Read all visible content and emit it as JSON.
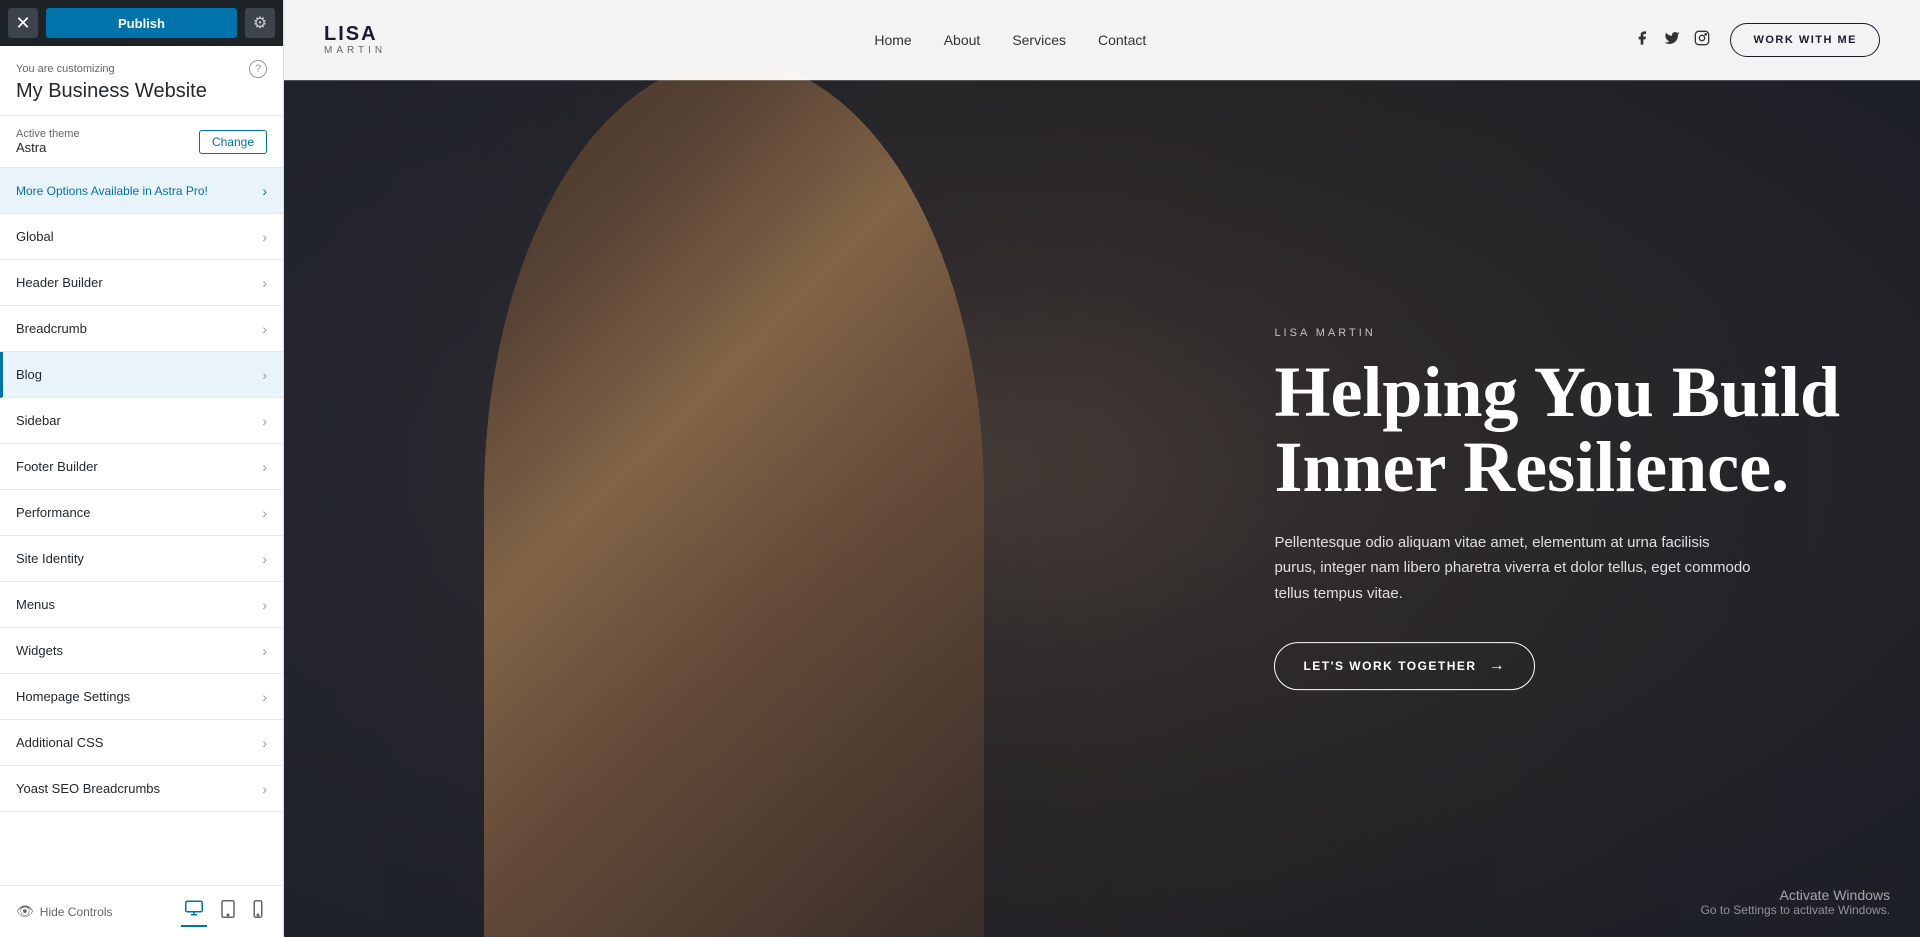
{
  "panel": {
    "topbar": {
      "close_label": "✕",
      "publish_label": "Publish",
      "settings_icon": "⚙"
    },
    "customizing": {
      "label": "You are customizing",
      "title": "My Business Website",
      "help_icon": "?"
    },
    "theme": {
      "label": "Active theme",
      "name": "Astra",
      "change_label": "Change"
    },
    "menu_items": [
      {
        "id": "astra-pro",
        "label": "More Options Available in Astra Pro!",
        "active": false,
        "astra": true
      },
      {
        "id": "global",
        "label": "Global",
        "active": false
      },
      {
        "id": "header-builder",
        "label": "Header Builder",
        "active": false
      },
      {
        "id": "breadcrumb",
        "label": "Breadcrumb",
        "active": false
      },
      {
        "id": "blog",
        "label": "Blog",
        "active": true
      },
      {
        "id": "sidebar",
        "label": "Sidebar",
        "active": false
      },
      {
        "id": "footer-builder",
        "label": "Footer Builder",
        "active": false
      },
      {
        "id": "performance",
        "label": "Performance",
        "active": false
      },
      {
        "id": "site-identity",
        "label": "Site Identity",
        "active": false
      },
      {
        "id": "menus",
        "label": "Menus",
        "active": false
      },
      {
        "id": "widgets",
        "label": "Widgets",
        "active": false
      },
      {
        "id": "homepage-settings",
        "label": "Homepage Settings",
        "active": false
      },
      {
        "id": "additional-css",
        "label": "Additional CSS",
        "active": false
      },
      {
        "id": "yoast-seo",
        "label": "Yoast SEO Breadcrumbs",
        "active": false
      }
    ],
    "bottom": {
      "hide_controls": "Hide Controls",
      "eye_icon": "👁",
      "device_desktop": "🖥",
      "device_tablet": "📱",
      "device_mobile": "📱"
    }
  },
  "website": {
    "logo": {
      "name": "LISA",
      "sub": "MARTIN"
    },
    "nav": {
      "links": [
        "Home",
        "About",
        "Services",
        "Contact"
      ]
    },
    "social": {
      "facebook": "f",
      "twitter": "t",
      "instagram": "ig"
    },
    "work_with_me": "WORK WITH ME",
    "hero": {
      "tag": "LISA MARTIN",
      "title_line1": "Helping You Build",
      "title_line2": "Inner Resilience.",
      "description": "Pellentesque odio aliquam vitae amet, elementum at urna facilisis purus, integer nam libero pharetra viverra et dolor tellus, eget commodo tellus tempus vitae.",
      "cta_label": "LET'S WORK TOGETHER",
      "cta_arrow": "→"
    },
    "activate_windows": {
      "title": "Activate Windows",
      "sub": "Go to Settings to activate Windows."
    }
  }
}
